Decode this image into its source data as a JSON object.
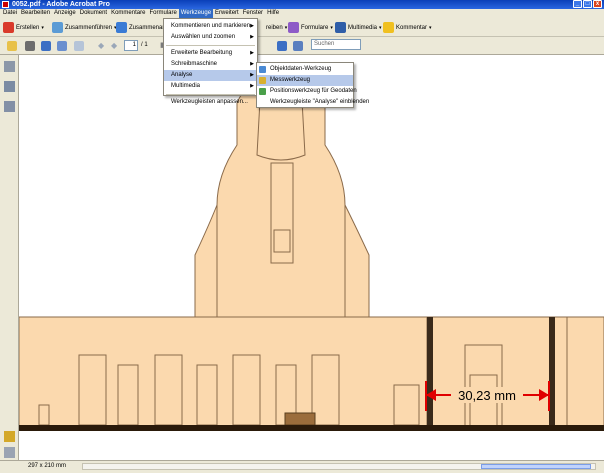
{
  "window": {
    "title": "0052.pdf - Adobe Acrobat Pro"
  },
  "menubar": [
    "Datei",
    "Bearbeiten",
    "Anzeige",
    "Dokument",
    "Kommentare",
    "Formulare",
    "Werkzeuge",
    "Erweitert",
    "Fenster",
    "Hilfe"
  ],
  "toolbar1": {
    "create": "Erstellen",
    "combine": "Zusammenführen",
    "collaborate": "Zusammenarb",
    "sign": "reiben",
    "forms": "Formulare",
    "multimedia": "Multimedia",
    "comment": "Kommentar"
  },
  "toolbar2": {
    "page_current": "1",
    "page_total": "/ 1",
    "search_placeholder": "Suchen"
  },
  "tools_menu": {
    "items": [
      {
        "label": "Kommentieren und markieren",
        "submenu": true
      },
      {
        "label": "Auswählen und zoomen",
        "submenu": true
      },
      {
        "label": "Erweiterte Bearbeitung",
        "submenu": true
      },
      {
        "label": "Schreibmaschine",
        "submenu": true
      },
      {
        "label": "Analyse",
        "submenu": true
      },
      {
        "label": "Multimedia",
        "submenu": true
      },
      {
        "label": "Werkzeugleisten anpassen..."
      }
    ]
  },
  "analyse_submenu": {
    "items": [
      {
        "label": "Objektdaten-Werkzeug"
      },
      {
        "label": "Messwerkzeug"
      },
      {
        "label": "Positionswerkzeug für Geodaten"
      },
      {
        "label": "Werkzeugleiste \"Analyse\" einblenden"
      }
    ]
  },
  "document": {
    "measurement": "30,23 mm"
  },
  "status": {
    "page_size": "297 x 210 mm"
  },
  "colors": {
    "sand": "#fbd9ae",
    "outline": "#8a6a4a",
    "measure": "#e00000",
    "menu_highlight": "#b6c9ea"
  }
}
